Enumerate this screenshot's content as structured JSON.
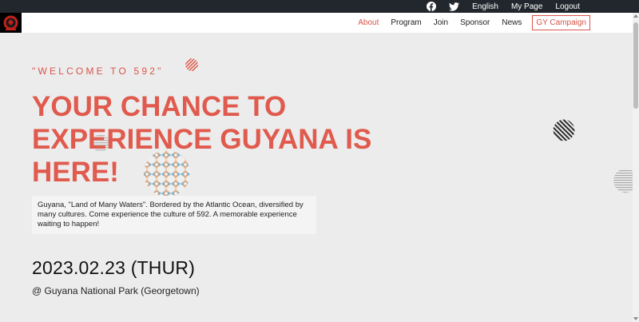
{
  "topbar": {
    "icons": [
      "facebook-icon",
      "twitter-icon"
    ],
    "links": [
      {
        "label": "English"
      },
      {
        "label": "My Page"
      },
      {
        "label": "Logout"
      }
    ]
  },
  "nav": {
    "items": [
      {
        "label": "About"
      },
      {
        "label": "Program"
      },
      {
        "label": "Join"
      },
      {
        "label": "Sponsor"
      },
      {
        "label": "News"
      },
      {
        "label": "GY Campaign"
      }
    ]
  },
  "hero": {
    "welcome": "\"WELCOME TO 592\"",
    "headline_line1": "YOUR CHANCE TO",
    "headline_line2": "EXPERIENCE GUYANA IS",
    "headline_line3": "HERE!",
    "description": "Guyana, \"Land of Many Waters\". Bordered by the Atlantic Ocean, diversified by many cultures. Come experience the culture of 592. A memorable experience waiting to happen!",
    "date": "2023.02.23 (THUR)",
    "venue": "@ Guyana National Park (Georgetown)"
  },
  "colors": {
    "accent": "#e05a4d",
    "topbar": "#22272d",
    "background": "#ececec"
  }
}
